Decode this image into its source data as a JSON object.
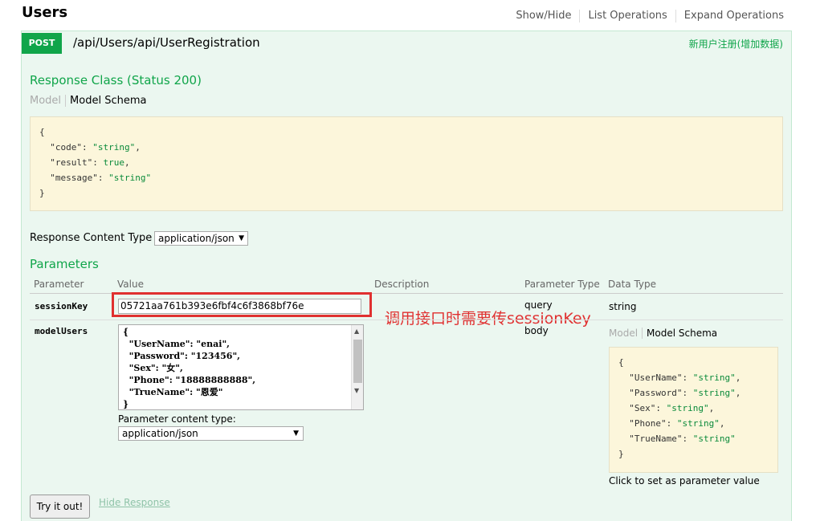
{
  "header": {
    "title": "Users",
    "links": [
      "Show/Hide",
      "List Operations",
      "Expand Operations"
    ]
  },
  "operation": {
    "method": "POST",
    "path": "/api/Users/api/UserRegistration",
    "summary": "新用户注册(增加数据)"
  },
  "response_class": {
    "heading": "Response Class (Status 200)",
    "tab_model": "Model",
    "tab_schema": "Model Schema",
    "schema_lines": [
      "{",
      "  \"code\": \"string\",",
      "  \"result\": true,",
      "  \"message\": \"string\"",
      "}"
    ]
  },
  "response_content_type": {
    "label": "Response Content Type",
    "selected": "application/json"
  },
  "parameters": {
    "heading": "Parameters",
    "columns": [
      "Parameter",
      "Value",
      "Description",
      "Parameter Type",
      "Data Type"
    ],
    "rows": [
      {
        "name": "sessionKey",
        "value": "05721aa761b393e6fbf4c6f3868bf76e",
        "description": "",
        "param_type": "query",
        "data_type": "string"
      },
      {
        "name": "modelUsers",
        "value_lines": [
          "{",
          "  \"UserName\": \"enai\",",
          "  \"Password\": \"123456\",",
          "  \"Sex\": \"女\",",
          "  \"Phone\": \"18888888888\",",
          "  \"TrueName\": \"恩爱\"",
          "}"
        ],
        "description": "",
        "param_type": "body",
        "content_type_label": "Parameter content type:",
        "content_type_selected": "application/json",
        "data_type_tab_model": "Model",
        "data_type_tab_schema": "Model Schema",
        "data_type_schema_lines": [
          "{",
          "  \"UserName\": \"string\",",
          "  \"Password\": \"string\",",
          "  \"Sex\": \"string\",",
          "  \"Phone\": \"string\",",
          "  \"TrueName\": \"string\"",
          "}"
        ],
        "click_hint": "Click to set as parameter value"
      }
    ]
  },
  "annotation": {
    "text": "调用接口时需要传sessionKey",
    "color": "#e03030"
  },
  "actions": {
    "try_label": "Try it out!",
    "hide_response_label": "Hide Response"
  },
  "colors": {
    "post_green": "#10a54a",
    "panel_bg": "#ebf7f0",
    "schema_bg": "#fcf6db"
  }
}
